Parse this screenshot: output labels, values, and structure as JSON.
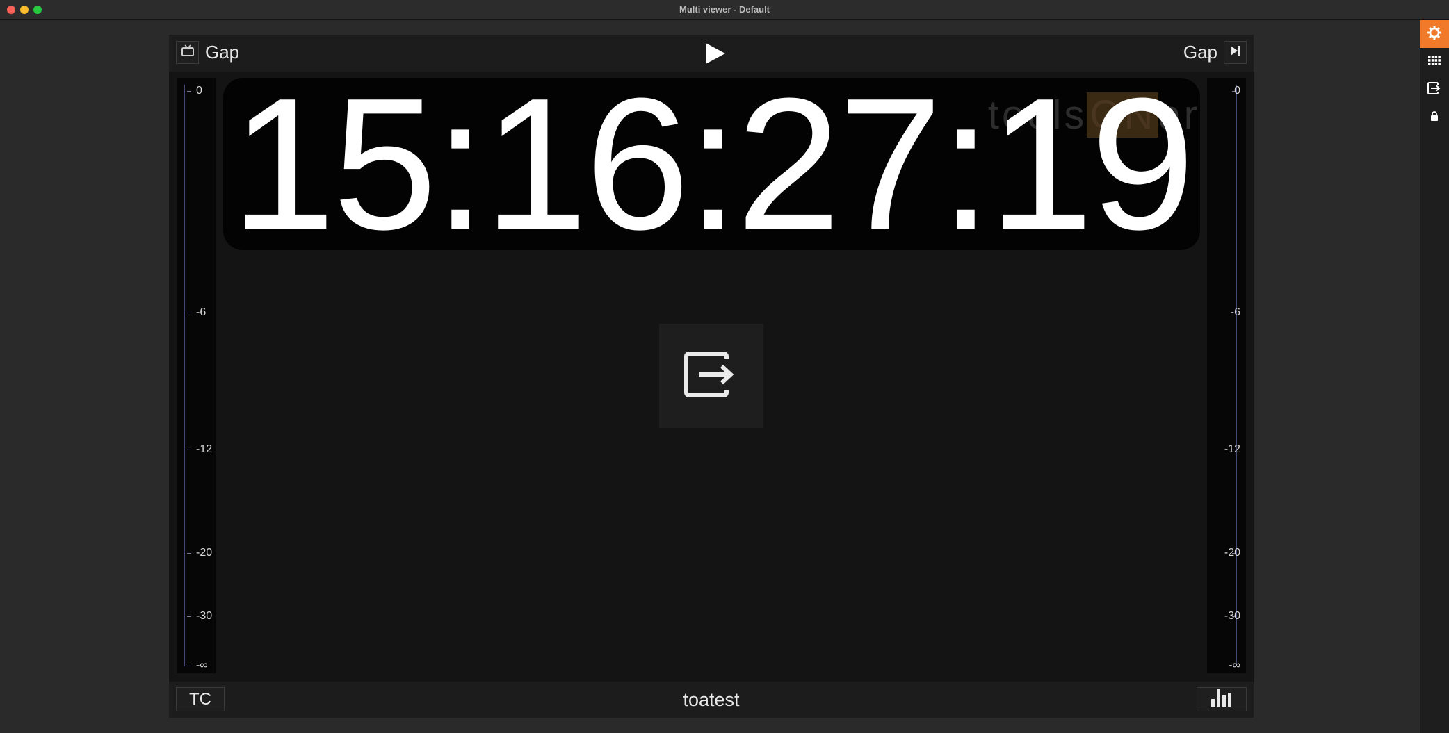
{
  "window": {
    "title": "Multi viewer - Default"
  },
  "topbar": {
    "left_label": "Gap",
    "right_label": "Gap",
    "source_icon": "tv-icon",
    "play_icon": "play-icon",
    "next_icon": "skip-next-icon"
  },
  "clock": {
    "time": "15:16:27:19",
    "watermark_pre": "tools",
    "watermark_on": "ON",
    "watermark_post": "ar"
  },
  "meter_scale": [
    "0",
    "-6",
    "-12",
    "-20",
    "-30",
    "-∞"
  ],
  "center_icon": "exit-to-app-icon",
  "bottombar": {
    "tc_label": "TC",
    "title": "toatest",
    "meter_icon": "bar-chart-icon"
  },
  "sidebar_icons": [
    "gear-icon",
    "grid-icon",
    "exit-icon",
    "lock-icon"
  ],
  "colors": {
    "accent": "#f07a2a",
    "background": "#141414",
    "text": "#ffffff"
  }
}
